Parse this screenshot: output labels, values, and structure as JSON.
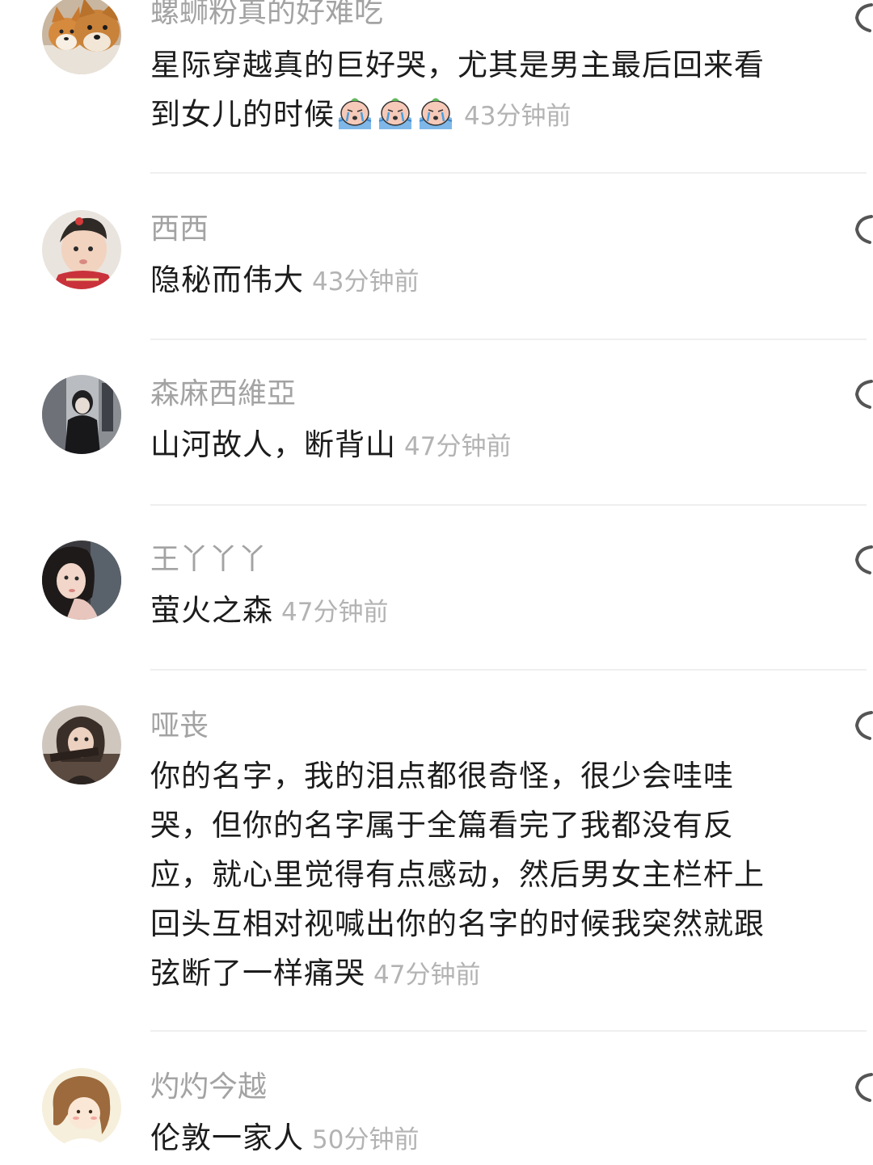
{
  "comments": [
    {
      "username": "螺蛳粉真的好难吃",
      "line1": "星际穿越真的巨好哭，尤其是男主最后回来看",
      "line2": "到女儿的时候",
      "emoji_icon": "crying-face-emoji",
      "emoji_count": 3,
      "time": "43分钟前",
      "avatar_icon": "shiba-dog-avatar"
    },
    {
      "username": "西西",
      "text": "隐秘而伟大",
      "time": "43分钟前",
      "avatar_icon": "baby-photo-avatar"
    },
    {
      "username": "森麻西維亞",
      "text": "山河故人，断背山",
      "time": "47分钟前",
      "avatar_icon": "mirror-selfie-avatar"
    },
    {
      "username": "王丫丫丫",
      "text": "萤火之森",
      "time": "47分钟前",
      "avatar_icon": "girl-portrait-avatar"
    },
    {
      "username": "哑丧",
      "lines": [
        "你的名字，我的泪点都很奇怪，很少会哇哇",
        "哭，但你的名字属于全篇看完了我都没有反",
        "应，就心里觉得有点感动，然后男女主栏杆上",
        "回头互相对视喊出你的名字的时候我突然就跟",
        "弦断了一样痛哭"
      ],
      "time": "47分钟前",
      "avatar_icon": "girl-selfie-avatar"
    },
    {
      "username": "灼灼今越",
      "text": "伦敦一家人",
      "time": "50分钟前",
      "avatar_icon": "cartoon-girl-avatar"
    }
  ],
  "reply_icon": "reply-bubble-icon",
  "colors": {
    "username": "#a3a3a3",
    "text": "#1c1c1c",
    "time": "#b3b3b3",
    "divider": "#efefef"
  }
}
